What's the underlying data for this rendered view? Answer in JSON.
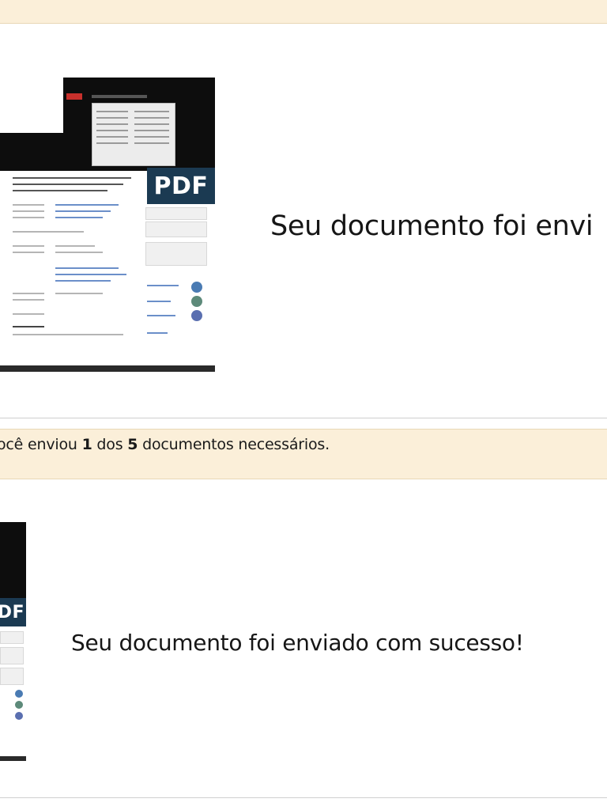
{
  "progress": {
    "prefix": "ocê enviou ",
    "sent": "1",
    "middle": " dos ",
    "total": "5",
    "suffix": " documentos necessários."
  },
  "uploads": [
    {
      "message": "Seu documento foi envi",
      "thumbnail_badge": "PDF"
    },
    {
      "message": "Seu documento foi enviado com sucesso!",
      "thumbnail_badge": "DF"
    }
  ],
  "colors": {
    "banner": "#fbefd9",
    "pdf_badge": "#1b3a52",
    "divider": "#cfcfcf"
  }
}
